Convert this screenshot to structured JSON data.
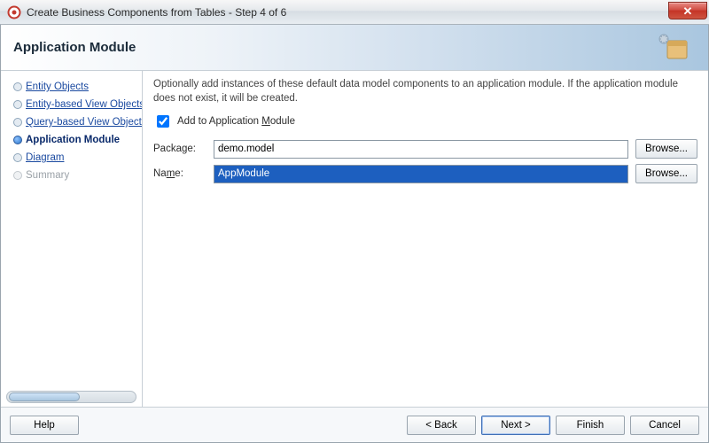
{
  "window": {
    "title": "Create Business Components from Tables - Step 4 of 6",
    "close_glyph": "✕"
  },
  "banner": {
    "heading": "Application Module"
  },
  "sidebar": {
    "items": [
      {
        "label": "Entity Objects",
        "state": "done"
      },
      {
        "label": "Entity-based View Objects",
        "state": "done"
      },
      {
        "label": "Query-based View Objects",
        "state": "done"
      },
      {
        "label": "Application Module",
        "state": "current"
      },
      {
        "label": "Diagram",
        "state": "upcoming"
      },
      {
        "label": "Summary",
        "state": "disabled"
      }
    ]
  },
  "content": {
    "description": "Optionally add instances of these default data model components to an application module.  If the application module does not exist, it will be created.",
    "checkbox_label_pre": "Add to Application ",
    "checkbox_label_u": "M",
    "checkbox_label_post": "odule",
    "checkbox_checked": true,
    "fields": {
      "package": {
        "label_pre": "Packa",
        "label_u": "g",
        "label_post": "e:",
        "value": "demo.model",
        "browse": "Browse..."
      },
      "name": {
        "label_pre": "Na",
        "label_u": "m",
        "label_post": "e:",
        "value": "AppModule",
        "browse": "Browse..."
      }
    }
  },
  "nav": {
    "help": "Help",
    "back": "< Back",
    "next": "Next >",
    "finish": "Finish",
    "cancel": "Cancel"
  }
}
